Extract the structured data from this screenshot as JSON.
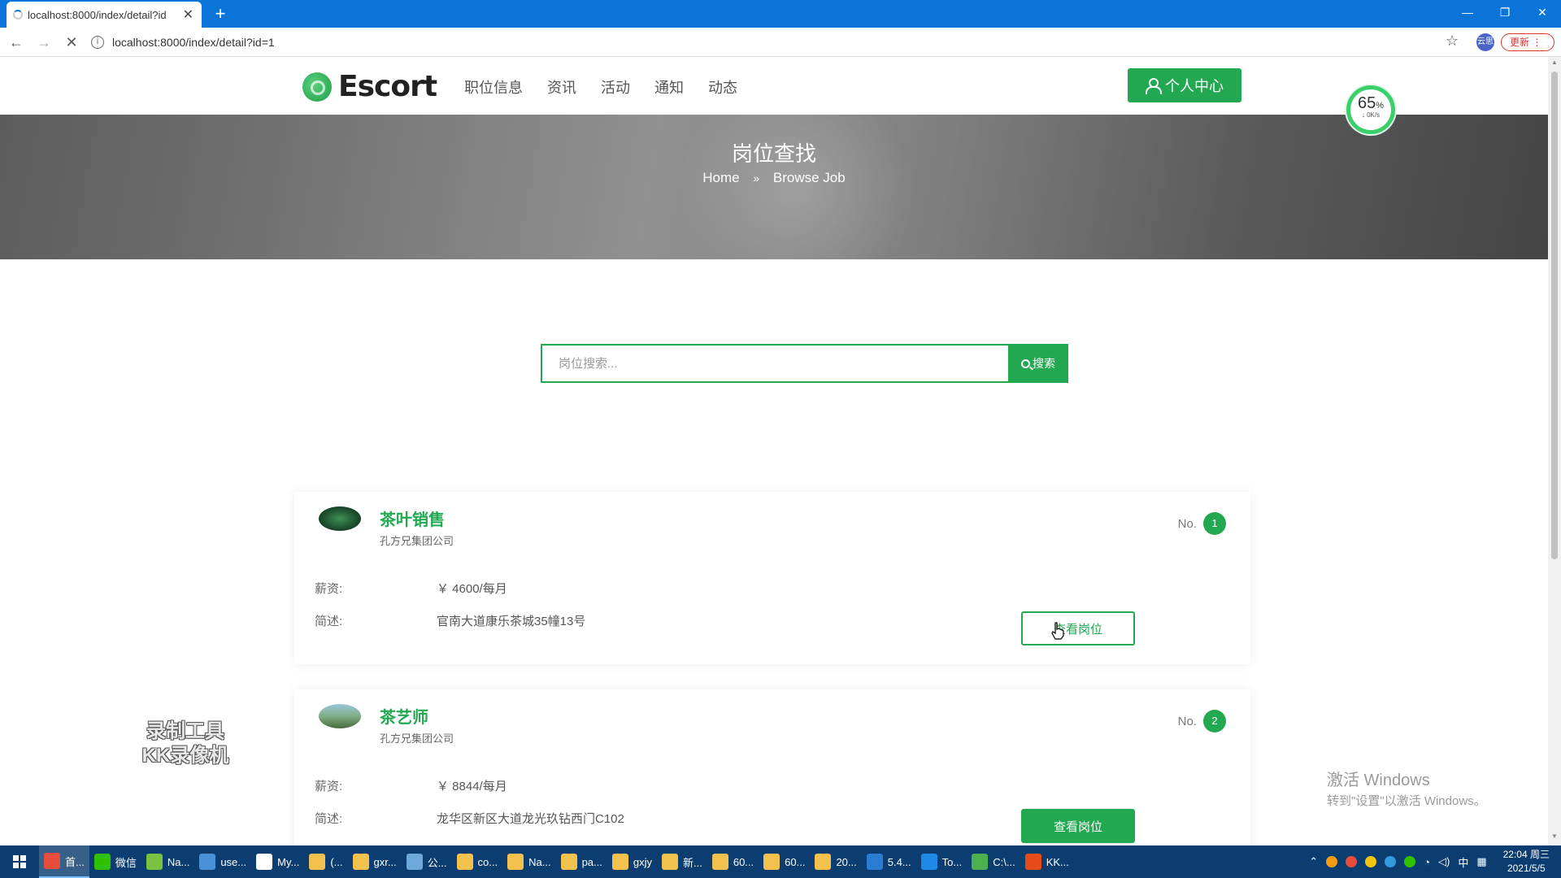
{
  "browser": {
    "tab_title": "localhost:8000/index/detail?id",
    "url": "localhost:8000/index/detail?id=1",
    "update_label": "更新",
    "ext_label": "云思"
  },
  "header": {
    "logo": "Escort",
    "nav": [
      "职位信息",
      "资讯",
      "活动",
      "通知",
      "动态"
    ],
    "profile_label": "个人中心"
  },
  "speed_widget": {
    "percent": "65",
    "unit": "%",
    "rate": "↓ 0K/s"
  },
  "banner": {
    "title": "岗位查找",
    "crumb_home": "Home",
    "crumb_sep": "»",
    "crumb_current": "Browse Job"
  },
  "search": {
    "placeholder": "岗位搜索...",
    "button_label": "搜索"
  },
  "jobs": [
    {
      "title": "茶叶销售",
      "company": "孔方兄集团公司",
      "no_label": "No.",
      "no": "1",
      "salary_label": "薪资:",
      "salary": "￥ 4600/每月",
      "desc_label": "简述:",
      "desc": "官南大道康乐茶城35幢13号",
      "button_label": "查看岗位"
    },
    {
      "title": "茶艺师",
      "company": "孔方兄集团公司",
      "no_label": "No.",
      "no": "2",
      "salary_label": "薪资:",
      "salary": "￥ 8844/每月",
      "desc_label": "简述:",
      "desc": "龙华区新区大道龙光玖钻西门C102",
      "button_label": "查看岗位"
    }
  ],
  "watermark": {
    "line1": "录制工具",
    "line2": "KK录像机"
  },
  "activate": {
    "line1": "激活 Windows",
    "line2": "转到\"设置\"以激活 Windows。"
  },
  "taskbar": {
    "items": [
      {
        "label": "首...",
        "color": "#e84c3d"
      },
      {
        "label": "微信",
        "color": "#2dc100"
      },
      {
        "label": "Na...",
        "color": "#7bc142"
      },
      {
        "label": "use...",
        "color": "#4a90d9"
      },
      {
        "label": "My...",
        "color": "#ffffff"
      },
      {
        "label": "(...",
        "color": "#f2c14e"
      },
      {
        "label": "gxr...",
        "color": "#f2c14e"
      },
      {
        "label": "公...",
        "color": "#6fa8dc"
      },
      {
        "label": "co...",
        "color": "#f2c14e"
      },
      {
        "label": "Na...",
        "color": "#f2c14e"
      },
      {
        "label": "pa...",
        "color": "#f2c14e"
      },
      {
        "label": "gxjy",
        "color": "#f2c14e"
      },
      {
        "label": "新...",
        "color": "#f2c14e"
      },
      {
        "label": "60...",
        "color": "#f2c14e"
      },
      {
        "label": "60...",
        "color": "#f2c14e"
      },
      {
        "label": "20...",
        "color": "#f2c14e"
      },
      {
        "label": "5.4...",
        "color": "#2b7cd3"
      },
      {
        "label": "To...",
        "color": "#1e88e5"
      },
      {
        "label": "C:\\...",
        "color": "#4caf50"
      },
      {
        "label": "KK...",
        "color": "#e64a19"
      }
    ],
    "ime": "中",
    "time": "22:04 周三",
    "date": "2021/5/5"
  },
  "colors": {
    "accent": "#21a850",
    "tabbar": "#0a74d8",
    "taskbar": "#0b3d70"
  }
}
